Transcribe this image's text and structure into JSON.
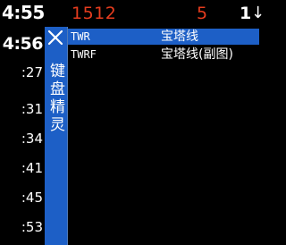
{
  "quote_bar": {
    "time": "4:55",
    "price": "1512",
    "volume": "5",
    "count": "1",
    "direction_icon": "sell-arrow-icon",
    "price_color": "#e63c1e"
  },
  "time_column": [
    {
      "label": "4:56",
      "highlight": true
    },
    {
      "label": ":27",
      "highlight": false
    },
    {
      "label": ":31",
      "highlight": false
    },
    {
      "label": ":34",
      "highlight": false
    },
    {
      "label": ":41",
      "highlight": false
    },
    {
      "label": ":45",
      "highlight": false
    },
    {
      "label": ":53",
      "highlight": false
    }
  ],
  "sprite": {
    "title": "键盘精灵",
    "close_icon": "close-icon",
    "accent_color": "#1d5fc6",
    "results": [
      {
        "code": "TWR",
        "name": "宝塔线",
        "selected": true
      },
      {
        "code": "TWRF",
        "name": "宝塔线(副图)",
        "selected": false
      }
    ]
  }
}
